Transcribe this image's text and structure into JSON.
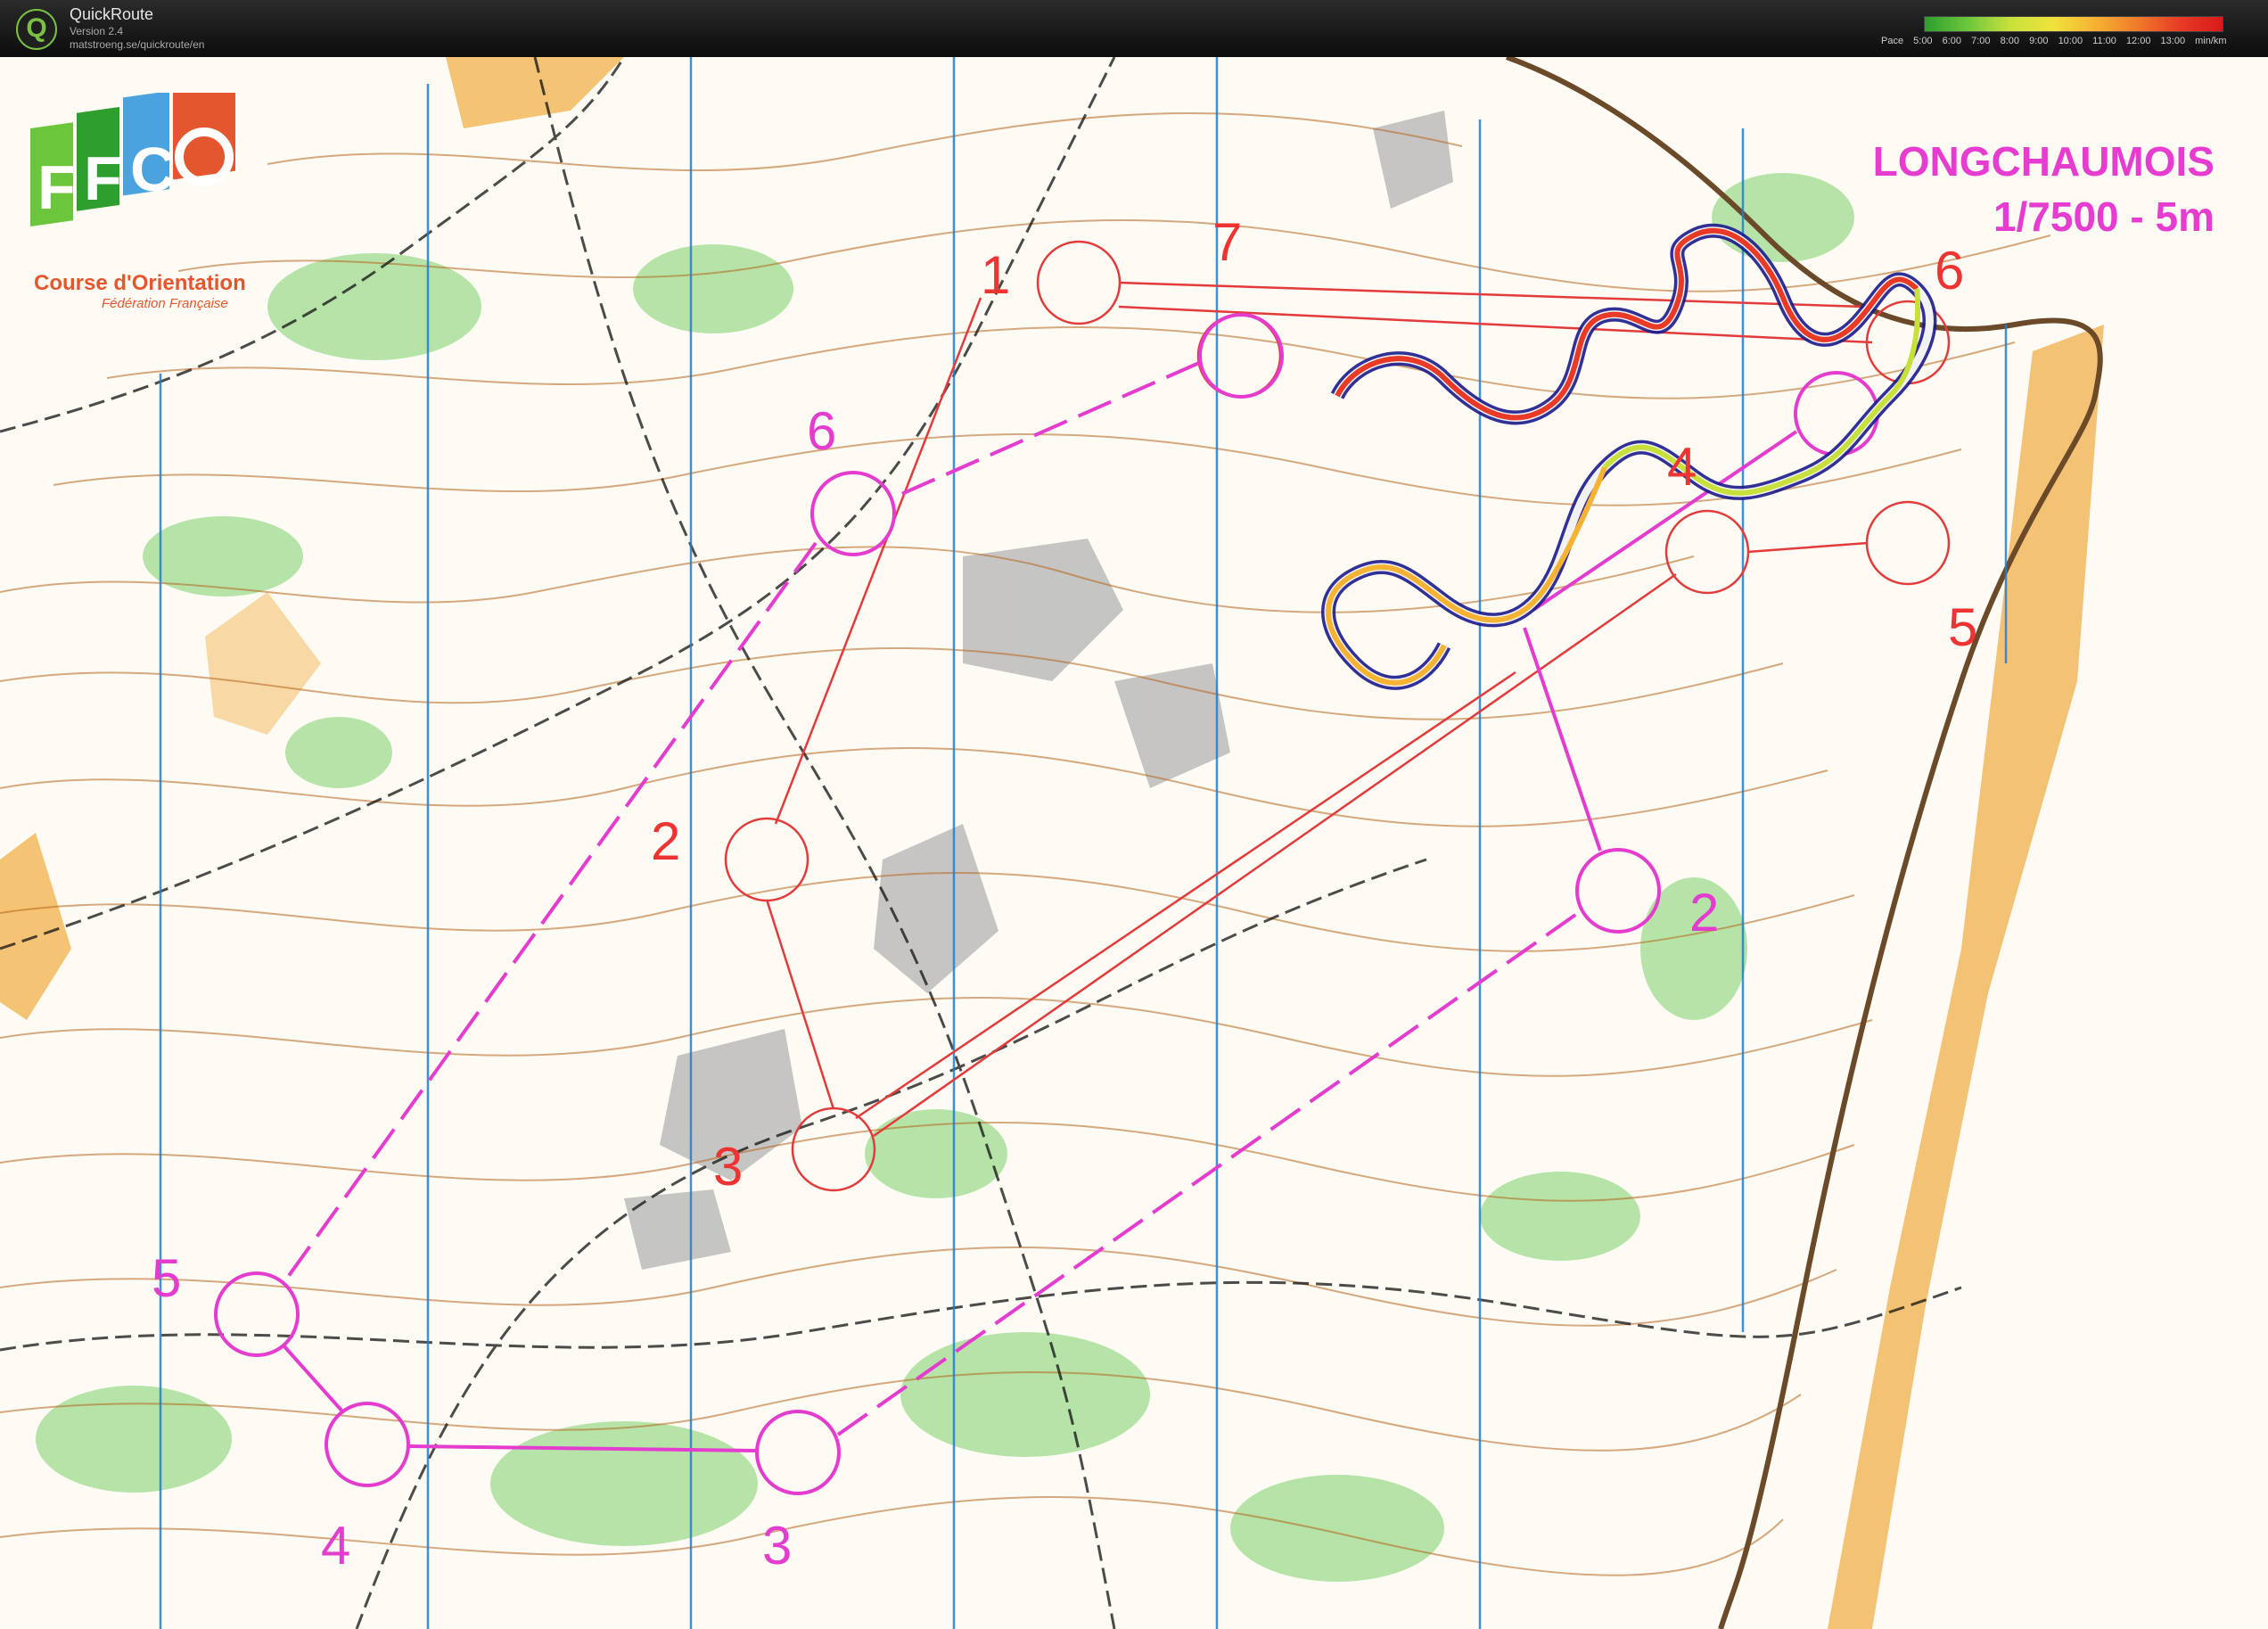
{
  "app": {
    "name": "QuickRoute",
    "version": "Version 2.4",
    "url": "matstroeng.se/quickroute/en",
    "icon": "quickroute-q-icon"
  },
  "pace_legend": {
    "label": "Pace",
    "unit": "min/km",
    "ticks": [
      "5:00",
      "6:00",
      "7:00",
      "8:00",
      "9:00",
      "10:00",
      "11:00",
      "12:00",
      "13:00"
    ],
    "colors": [
      "#2e9e2e",
      "#6cc63c",
      "#c8e03c",
      "#f0e23c",
      "#f6b232",
      "#f07a2a",
      "#e83a26",
      "#d81a1a"
    ]
  },
  "map": {
    "title_line1": "LONGCHAUMOIS",
    "title_line2": "1/7500 - 5m",
    "logo_letters": "FFCO",
    "logo_text": "Course d'Orientation",
    "logo_sub": "Fédération Française",
    "magenta_controls": [
      "6",
      "2",
      "5",
      "4",
      "3"
    ],
    "red_controls": [
      "1",
      "7",
      "2",
      "3",
      "4",
      "5",
      "6"
    ],
    "colors": {
      "course": "#e43ccf",
      "second_course": "#e33b3b",
      "route_outline": "#1a1a8c",
      "contour": "#b5651d",
      "vegetation": "#7bd16a",
      "open_land": "#f2b04a",
      "rock": "#b8b8b8",
      "north_lines": "#1f7fd1"
    }
  }
}
